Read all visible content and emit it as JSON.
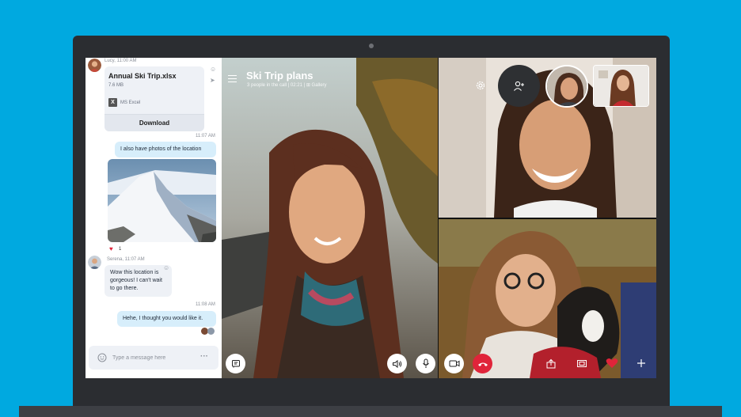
{
  "chat": {
    "first_sender": "Lucy, 11:00 AM",
    "file": {
      "name": "Annual Ski Trip.xlsx",
      "size": "7.6 MB",
      "app_badge": "X",
      "app": "MS Excel",
      "download_label": "Download"
    },
    "messages": [
      {
        "time": "11:07 AM",
        "text": "I also have photos of the location",
        "direction": "outgoing"
      },
      {
        "photo": "mountain-photo",
        "reaction_count": "1"
      },
      {
        "sender": "Serena, 11:07 AM",
        "text": "Wow this location is gorgeous! I can't wait to go there.",
        "direction": "incoming"
      },
      {
        "time": "11:08 AM",
        "text": "Hehe, I thought you would like it.",
        "direction": "outgoing"
      }
    ],
    "composer": {
      "placeholder": "Type a message here",
      "more": "···"
    }
  },
  "call": {
    "title": "Ski Trip plans",
    "subtitle": "3 people in the call | 02:21 | ⊞ Gallery",
    "controls_left": [
      "chat-icon"
    ],
    "controls_mid": [
      "speaker-icon",
      "microphone-icon",
      "video-camera-icon",
      "end-call-icon"
    ],
    "controls_right": [
      "share-screen-icon",
      "screenshot-icon",
      "heart-icon",
      "plus-icon"
    ],
    "top_right": [
      "settings-icon",
      "add-person-icon"
    ]
  },
  "colors": {
    "background": "#00a9e0",
    "end_call": "#e0243a",
    "outgoing_bubble": "#d7eefb",
    "incoming_bubble": "#eef1f6"
  }
}
